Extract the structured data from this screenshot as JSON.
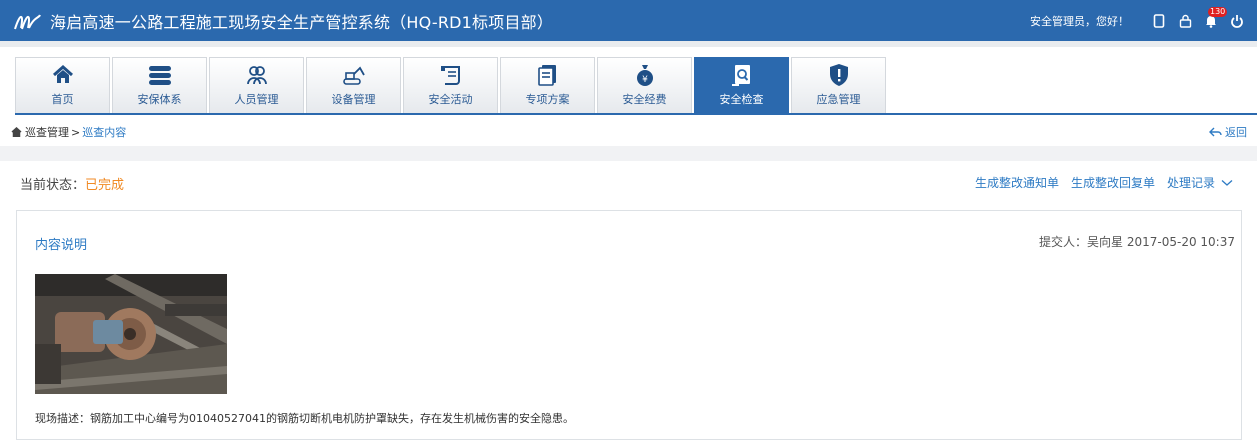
{
  "header": {
    "title": "海启高速一公路工程施工现场安全生产管控系统（HQ-RD1标项目部）",
    "greeting": "安全管理员，您好！",
    "notification_count": "130",
    "icons": [
      "mobile-icon",
      "lock-icon",
      "bell-icon",
      "power-icon"
    ]
  },
  "nav": {
    "tabs": [
      {
        "label": "首页",
        "icon": "home-icon"
      },
      {
        "label": "安保体系",
        "icon": "layers-icon"
      },
      {
        "label": "人员管理",
        "icon": "people-icon"
      },
      {
        "label": "设备管理",
        "icon": "excavator-icon"
      },
      {
        "label": "安全活动",
        "icon": "scroll-icon"
      },
      {
        "label": "专项方案",
        "icon": "document-icon"
      },
      {
        "label": "安全经费",
        "icon": "money-bag-icon"
      },
      {
        "label": "安全检查",
        "icon": "inspect-icon",
        "active": true
      },
      {
        "label": "应急管理",
        "icon": "shield-icon"
      }
    ]
  },
  "breadcrumb": {
    "parent": "巡查管理",
    "separator": ">",
    "current": "巡查内容",
    "back_label": "返回"
  },
  "status": {
    "label": "当前状态：",
    "value": "已完成"
  },
  "actions": {
    "notice": "生成整改通知单",
    "reply": "生成整改回复单",
    "records": "处理记录"
  },
  "detail": {
    "title": "内容说明",
    "submitter": "提交人：吴向星  2017-05-20 10:37",
    "description": "现场描述：钢筋加工中心编号为01040527041的钢筋切断机电机防护罩缺失，存在发生机械伤害的安全隐患。"
  },
  "colors": {
    "brand_blue": "#2b69ae",
    "link_blue": "#2e7bc4",
    "status_orange": "#f08a24",
    "badge_red": "#e02020"
  }
}
